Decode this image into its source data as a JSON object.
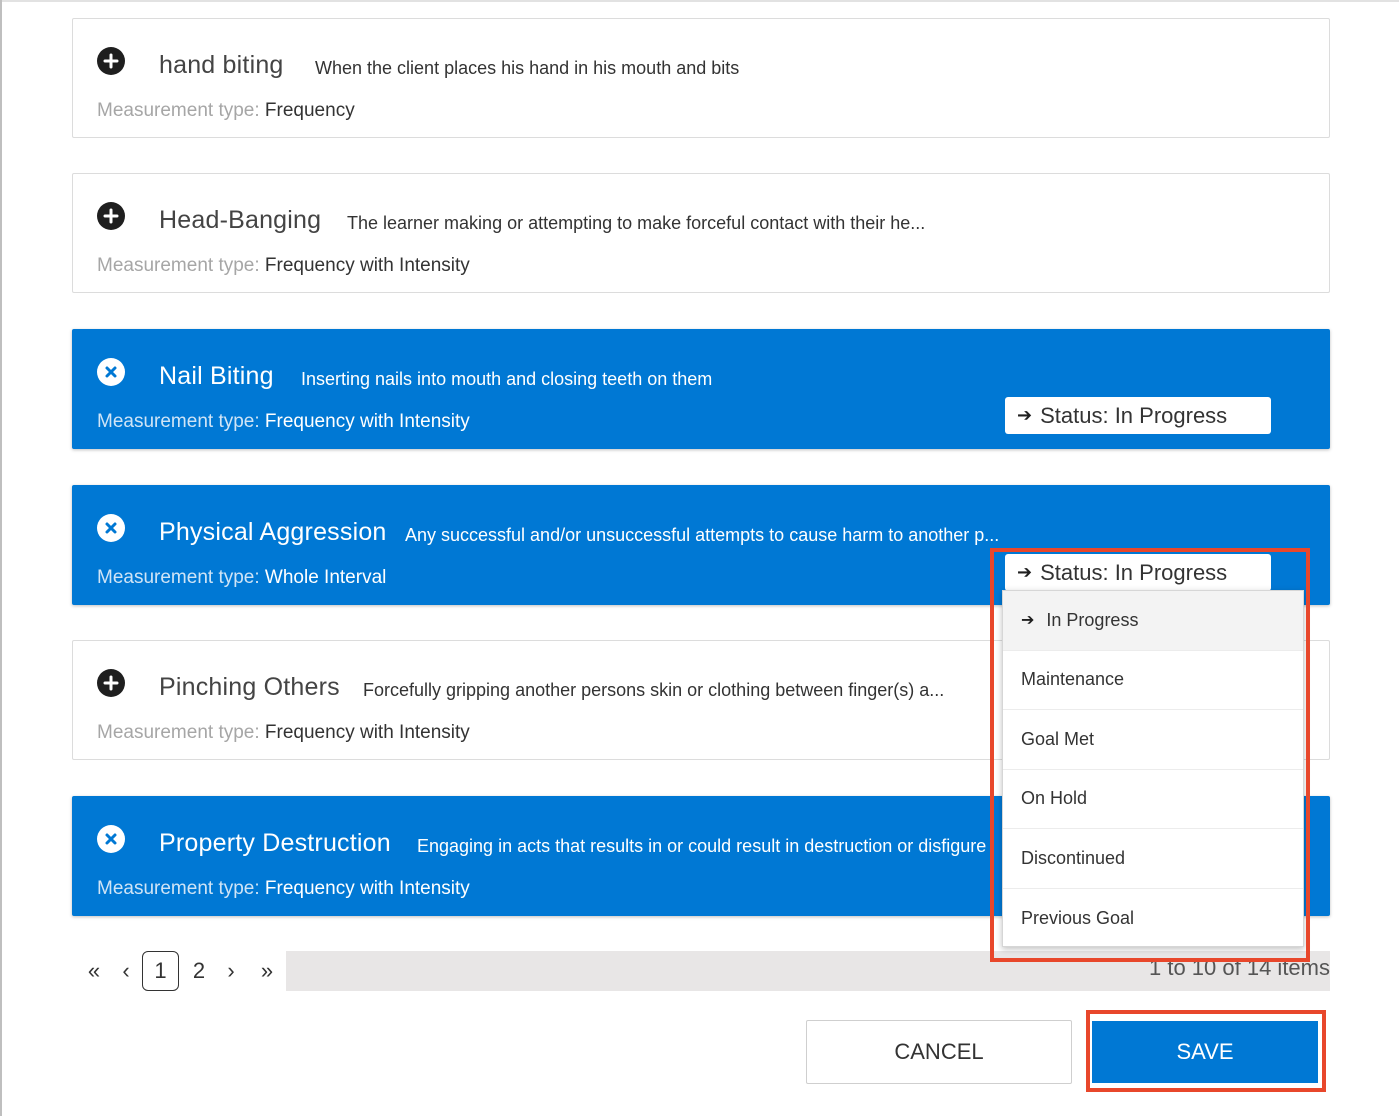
{
  "behaviors": [
    {
      "name": "hand biting",
      "description": "When the client places his hand in his mouth and bits",
      "measurement_label": "Measurement type:",
      "measurement_value": "Frequency",
      "selected": false,
      "toggle_icon": "plus-circle-icon"
    },
    {
      "name": "Head-Banging",
      "description": "The learner making or attempting to make forceful contact with their he...",
      "measurement_label": "Measurement type:",
      "measurement_value": "Frequency with Intensity",
      "selected": false,
      "toggle_icon": "plus-circle-icon"
    },
    {
      "name": "Nail Biting",
      "description": "Inserting nails into mouth and closing teeth on them",
      "measurement_label": "Measurement type:",
      "measurement_value": "Frequency with Intensity",
      "selected": true,
      "toggle_icon": "close-circle-icon",
      "status": "Status: In Progress"
    },
    {
      "name": "Physical Aggression",
      "description": "Any successful and/or unsuccessful attempts to cause harm to another p...",
      "measurement_label": "Measurement type:",
      "measurement_value": "Whole Interval",
      "selected": true,
      "toggle_icon": "close-circle-icon",
      "status": "Status: In Progress"
    },
    {
      "name": "Pinching Others",
      "description": "Forcefully gripping another persons skin or clothing between finger(s) a...",
      "measurement_label": "Measurement type:",
      "measurement_value": "Frequency with Intensity",
      "selected": false,
      "toggle_icon": "plus-circle-icon"
    },
    {
      "name": "Property Destruction",
      "description": "Engaging in acts that results in or could result in destruction or disfigure",
      "measurement_label": "Measurement type:",
      "measurement_value": "Frequency with Intensity",
      "selected": true,
      "toggle_icon": "close-circle-icon"
    }
  ],
  "status_dropdown": {
    "options": [
      "In Progress",
      "Maintenance",
      "Goal Met",
      "On Hold",
      "Discontinued",
      "Previous Goal"
    ],
    "selected": "In Progress"
  },
  "pagination": {
    "first": "«",
    "prev": "‹",
    "pages": [
      "1",
      "2"
    ],
    "current_page": "1",
    "next": "›",
    "last": "»",
    "items_info": "1 to 10 of 14 items"
  },
  "footer": {
    "cancel_label": "CANCEL",
    "save_label": "SAVE"
  },
  "colors": {
    "accent": "#0078d4",
    "highlight": "#e8472b"
  }
}
